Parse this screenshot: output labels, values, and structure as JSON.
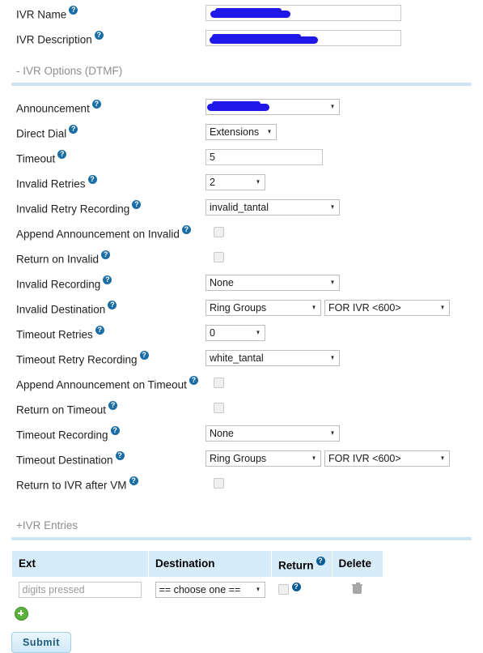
{
  "form": {
    "name_label": "IVR Name",
    "name_value": "",
    "description_label": "IVR Description",
    "description_value": ""
  },
  "options_section": {
    "title": "- IVR Options (DTMF)",
    "rows": [
      {
        "label": "Announcement",
        "value": ""
      },
      {
        "label": "Direct Dial",
        "value": "Extensions"
      },
      {
        "label": "Timeout",
        "value": "5"
      },
      {
        "label": "Invalid Retries",
        "value": "2"
      },
      {
        "label": "Invalid Retry Recording",
        "value": "invalid_tantal"
      },
      {
        "label": "Append Announcement on Invalid",
        "value": ""
      },
      {
        "label": "Return on Invalid",
        "value": ""
      },
      {
        "label": "Invalid Recording",
        "value": "None"
      },
      {
        "label": "Invalid Destination",
        "value": "Ring Groups",
        "value2": "FOR IVR <600>"
      },
      {
        "label": "Timeout Retries",
        "value": "0"
      },
      {
        "label": "Timeout Retry Recording",
        "value": "white_tantal"
      },
      {
        "label": "Append Announcement on Timeout",
        "value": ""
      },
      {
        "label": "Return on Timeout",
        "value": ""
      },
      {
        "label": "Timeout Recording",
        "value": "None"
      },
      {
        "label": "Timeout Destination",
        "value": "Ring Groups",
        "value2": "FOR IVR <600>"
      },
      {
        "label": "Return to IVR after VM",
        "value": ""
      }
    ]
  },
  "entries_section": {
    "title": "+IVR Entries",
    "columns": [
      "Ext",
      "Destination",
      "Return",
      "Delete"
    ],
    "rows": [
      {
        "ext_placeholder": "digits pressed",
        "ext_value": "",
        "destination": "== choose one =="
      }
    ]
  },
  "actions": {
    "submit_label": "Submit",
    "add_label": "+"
  },
  "colors": {
    "help_icon": "#1b6ea5",
    "table_header": "#d6ecf8",
    "rule": "#cfe4f2",
    "redaction": "#1f18e8",
    "add_button": "#5cb33c",
    "submit_text": "#1f5a7a"
  }
}
